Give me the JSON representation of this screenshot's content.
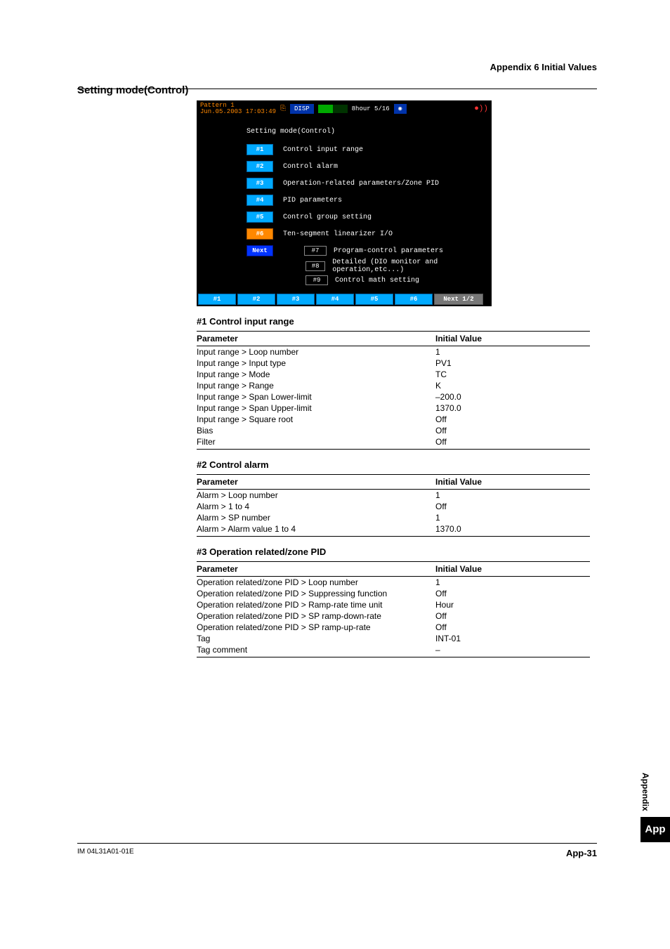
{
  "header": {
    "appendix_title": "Appendix 6  Initial Values",
    "section_title": "Setting mode(Control)"
  },
  "screenshot": {
    "pattern_line1": "Pattern 1",
    "pattern_line2": "Jun.05.2003 17:03:49",
    "disp": "DISP",
    "right_info": "8hour 5/16",
    "body_title": "Setting mode(Control)",
    "menu": [
      {
        "btn": "#1",
        "style": "blue",
        "label": "Control input range"
      },
      {
        "btn": "#2",
        "style": "blue",
        "label": "Control alarm"
      },
      {
        "btn": "#3",
        "style": "blue",
        "label": "Operation-related parameters/Zone PID"
      },
      {
        "btn": "#4",
        "style": "blue",
        "label": "PID parameters"
      },
      {
        "btn": "#5",
        "style": "blue",
        "label": "Control group setting"
      },
      {
        "btn": "#6",
        "style": "orange",
        "label": "Ten-segment linearizer I/O"
      },
      {
        "btn": "Next",
        "style": "next",
        "label": ""
      }
    ],
    "submenu": [
      {
        "num": "#7",
        "label": "Program-control parameters"
      },
      {
        "num": "#8",
        "label": "Detailed (DIO monitor and operation,etc...)"
      },
      {
        "num": "#9",
        "label": "Control math setting"
      }
    ],
    "bottom": [
      {
        "label": "#1",
        "grey": false
      },
      {
        "label": "#2",
        "grey": false
      },
      {
        "label": "#3",
        "grey": false
      },
      {
        "label": "#4",
        "grey": false
      },
      {
        "label": "#5",
        "grey": false
      },
      {
        "label": "#6",
        "grey": false
      },
      {
        "label": "Next 1/2",
        "grey": true
      }
    ]
  },
  "tables": [
    {
      "title": "#1 Control input range",
      "header": {
        "param": "Parameter",
        "value": "Initial Value"
      },
      "rows": [
        {
          "param": "Input range > Loop number",
          "value": "1"
        },
        {
          "param": "Input range > Input type",
          "value": "PV1"
        },
        {
          "param": "Input range > Mode",
          "value": "TC"
        },
        {
          "param": "Input range > Range",
          "value": "K"
        },
        {
          "param": "Input range > Span Lower-limit",
          "value": "–200.0"
        },
        {
          "param": "Input range > Span Upper-limit",
          "value": "1370.0"
        },
        {
          "param": "Input range > Square root",
          "value": "Off"
        },
        {
          "param": "Bias",
          "value": "Off"
        },
        {
          "param": "Filter",
          "value": "Off"
        }
      ]
    },
    {
      "title": "#2 Control alarm",
      "header": {
        "param": "Parameter",
        "value": "Initial Value"
      },
      "rows": [
        {
          "param": "Alarm > Loop number",
          "value": "1"
        },
        {
          "param": "Alarm > 1 to 4",
          "value": "Off"
        },
        {
          "param": "Alarm > SP number",
          "value": "1"
        },
        {
          "param": "Alarm > Alarm value 1 to 4",
          "value": "1370.0"
        }
      ]
    },
    {
      "title": "#3 Operation related/zone PID",
      "header": {
        "param": "Parameter",
        "value": "Initial Value"
      },
      "rows": [
        {
          "param": "Operation related/zone PID > Loop number",
          "value": "1"
        },
        {
          "param": "Operation related/zone PID > Suppressing function",
          "value": "Off"
        },
        {
          "param": "Operation related/zone PID > Ramp-rate time unit",
          "value": "Hour"
        },
        {
          "param": "Operation related/zone PID > SP ramp-down-rate",
          "value": "Off"
        },
        {
          "param": "Operation related/zone PID > SP ramp-up-rate",
          "value": "Off"
        },
        {
          "param": "Tag",
          "value": "INT-01"
        },
        {
          "param": "Tag comment",
          "value": "–"
        }
      ]
    }
  ],
  "sidebar": {
    "text": "Appendix",
    "tab": "App"
  },
  "footer": {
    "left": "IM 04L31A01-01E",
    "right": "App-31"
  }
}
